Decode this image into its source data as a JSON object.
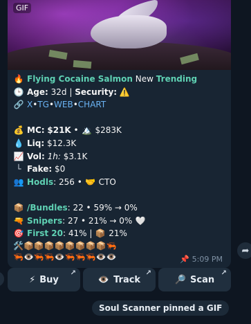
{
  "media": {
    "badge": "GIF"
  },
  "message": {
    "title": {
      "icon": "fire-icon",
      "name": "Flying Cocaine Salmon",
      "middle": "New",
      "tag": "Trending"
    },
    "age": {
      "label": "Age:",
      "value": "32d",
      "sep": "|",
      "security_label": "Security:",
      "security_icon": "⚠️"
    },
    "links": [
      "X",
      "TG",
      "WEB",
      "CHART"
    ],
    "mc": {
      "label": "MC:",
      "value": "$21K",
      "ath": "$283K"
    },
    "liq": {
      "label": "Liq:",
      "value": "$12.3K"
    },
    "vol": {
      "label": "Vol:",
      "period": "1h:",
      "value": "$3.1K"
    },
    "fake": {
      "label": "Fake:",
      "value": "$0"
    },
    "hodls": {
      "label": "Hodls",
      "value": ": 256 •",
      "cto": "CTO"
    },
    "bundles": {
      "label": "/Bundles",
      "value": ": 22 • 59% → 0%"
    },
    "snipers": {
      "label": "Snipers",
      "value": ": 27 • 21% → 0%"
    },
    "first20": {
      "label": "First 20",
      "value": ": 41% |",
      "value2": "21%"
    },
    "emoji_row1": "🛠️📦📦📦📦📦📦📦📦🦐",
    "emoji_row2": "🦐👁️🦐🦐👁️🦐🦐🦐👁️👁️",
    "time": "5:09 PM"
  },
  "keyboard": [
    {
      "icon": "⚡",
      "label": "Buy"
    },
    {
      "icon": "👁️",
      "label": "Track"
    },
    {
      "icon": "🔎",
      "label": "Scan"
    }
  ],
  "service_message": "Soul Scanner pinned a GIF"
}
